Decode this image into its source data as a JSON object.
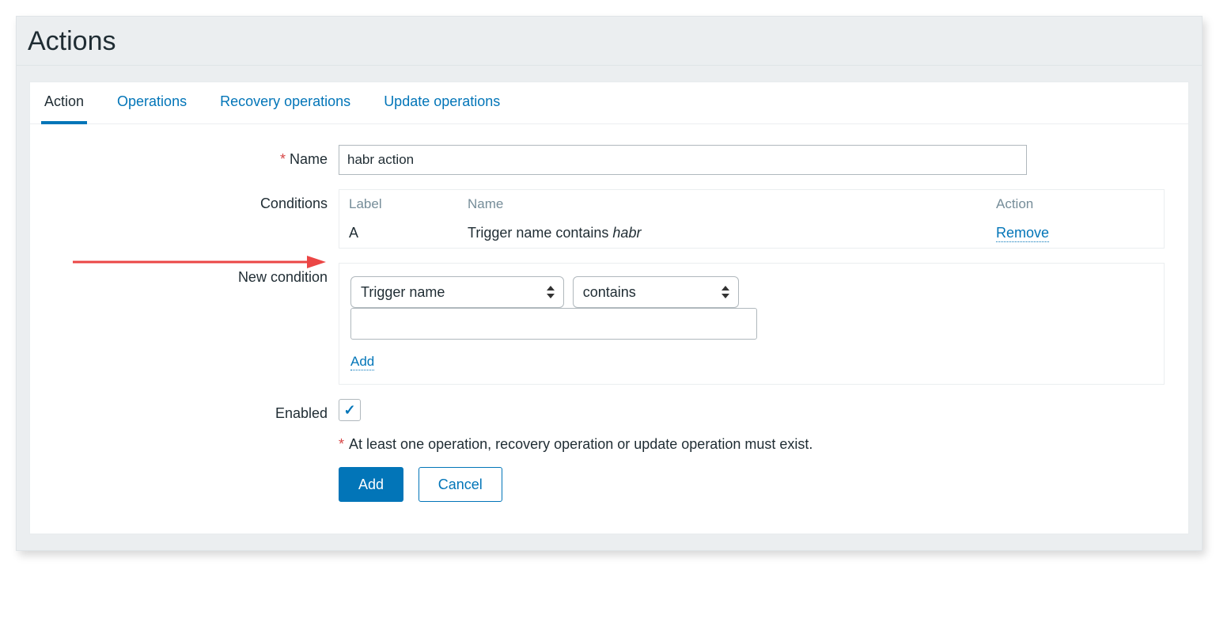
{
  "page_title": "Actions",
  "tabs": {
    "action": "Action",
    "operations": "Operations",
    "recovery": "Recovery operations",
    "update": "Update operations"
  },
  "form": {
    "name_label": "Name",
    "name_value": "habr action",
    "conditions_label": "Conditions",
    "cond_headers": {
      "label": "Label",
      "name": "Name",
      "action": "Action"
    },
    "cond_rows": [
      {
        "label": "A",
        "name_prefix": "Trigger name contains ",
        "name_value": "habr",
        "action": "Remove"
      }
    ],
    "new_condition_label": "New condition",
    "nc_type": "Trigger name",
    "nc_op": "contains",
    "nc_value": "",
    "nc_add": "Add",
    "enabled_label": "Enabled",
    "enabled_checked": true,
    "note": "At least one operation, recovery operation or update operation must exist.",
    "btn_add": "Add",
    "btn_cancel": "Cancel"
  }
}
